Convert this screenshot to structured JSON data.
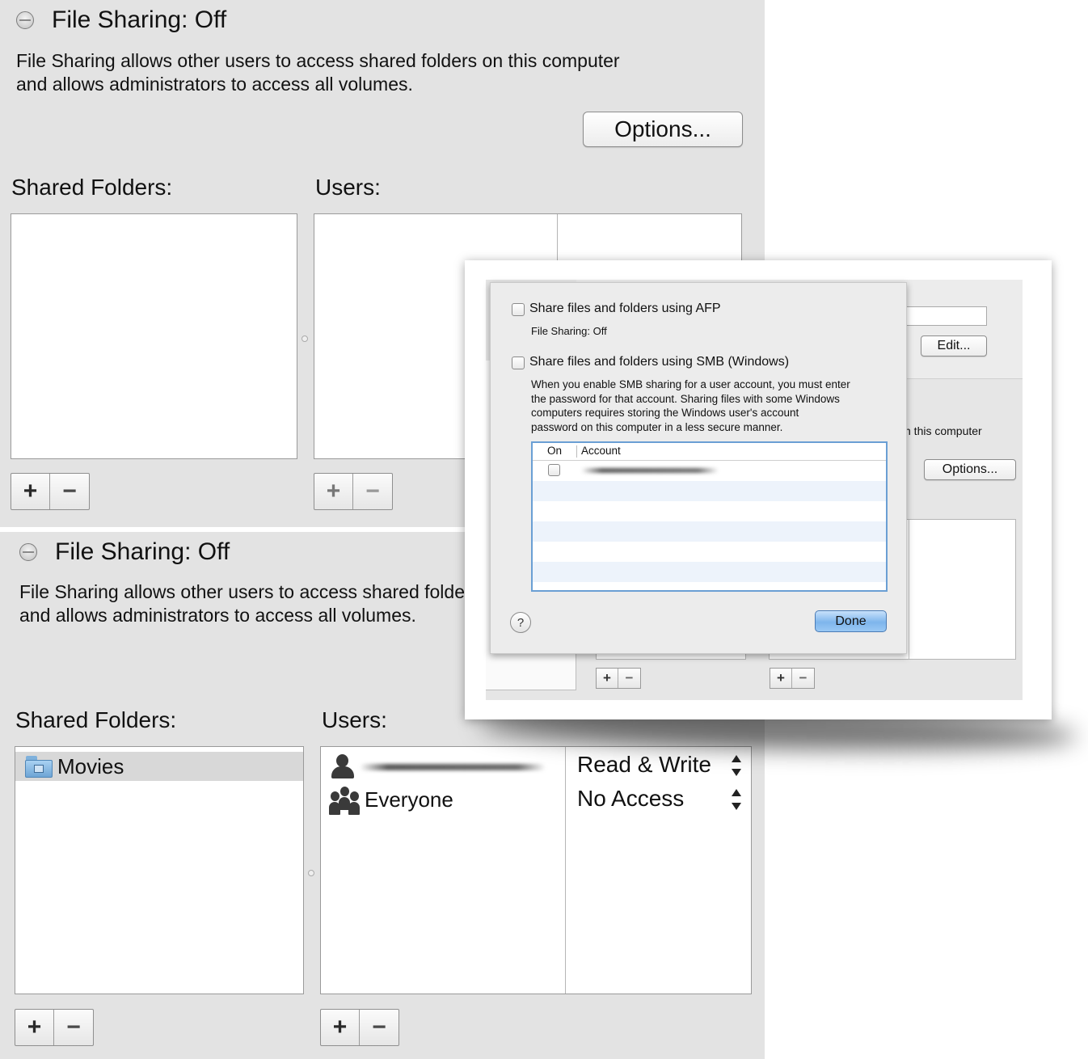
{
  "top_panel": {
    "status_title": "File Sharing: Off",
    "description": "File Sharing allows other users to access shared folders on this computer\nand allows administrators to access all volumes.",
    "options_button": "Options...",
    "shared_folders_label": "Shared Folders:",
    "users_label": "Users:",
    "plus": "+",
    "minus": "−"
  },
  "bottom_panel": {
    "status_title": "File Sharing: Off",
    "description": "File Sharing allows other users to access shared folders on this computer\nand allows administrators to access all volumes.",
    "shared_folders_label": "Shared Folders:",
    "users_label": "Users:",
    "folders": [
      {
        "name": "Movies",
        "icon": "movies-folder-icon",
        "selected": true
      }
    ],
    "users": [
      {
        "name": "",
        "icon": "person-icon",
        "permission": "Read & Write",
        "name_redacted": true
      },
      {
        "name": "Everyone",
        "icon": "group-icon",
        "permission": "No Access"
      }
    ],
    "plus": "+",
    "minus": "−"
  },
  "options_sheet": {
    "afp_label": "Share files and folders using AFP",
    "afp_status": "File Sharing: Off",
    "smb_label": "Share files and folders using SMB (Windows)",
    "smb_description": "When you enable SMB sharing for a user account, you must enter\nthe password for that account. Sharing files with some Windows\ncomputers requires storing the Windows user's account\npassword on this computer in a less secure manner.",
    "table_columns": [
      "On",
      "Account"
    ],
    "accounts": [
      {
        "on": false,
        "name": "",
        "name_redacted": true
      }
    ],
    "help_button": "?",
    "done_button": "Done"
  },
  "background_window": {
    "edit_button": "Edit...",
    "options_button": "Options...",
    "partial_text": "n this computer",
    "plus": "+",
    "minus": "−"
  },
  "colors": {
    "panel_bg": "#e3e3e3",
    "selection_bg": "#d8d8d8",
    "table_focus_border": "#6a9fd4",
    "done_button_blue": "#7eb5ec"
  }
}
